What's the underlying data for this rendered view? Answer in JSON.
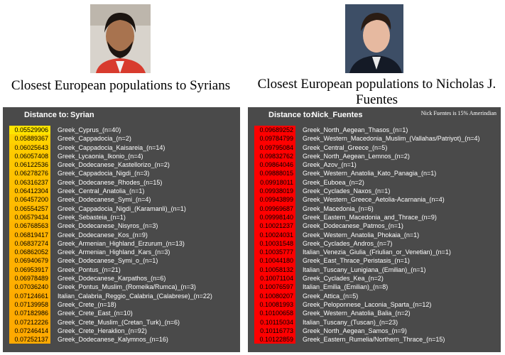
{
  "left": {
    "caption": "Closest European populations to Syrians",
    "header": {
      "label": "Distance to:",
      "population": "Syrian"
    },
    "rows": [
      {
        "value": "0.05529906",
        "name": "Greek_Cyprus_(n=40)",
        "color": "#ffe400"
      },
      {
        "value": "0.05889367",
        "name": "Greek_Cappadocia_(n=2)",
        "color": "#ffd200"
      },
      {
        "value": "0.06025643",
        "name": "Greek_Cappadocia_Kaisareia_(n=14)",
        "color": "#ffcc00"
      },
      {
        "value": "0.06057408",
        "name": "Greek_Lycaonia_Ikonio_(n=4)",
        "color": "#ffca00"
      },
      {
        "value": "0.06122536",
        "name": "Greek_Dodecanese_Kastellorizo_(n=2)",
        "color": "#ffc700"
      },
      {
        "value": "0.06278276",
        "name": "Greek_Cappadocia_Nigdi_(n=3)",
        "color": "#ffc200"
      },
      {
        "value": "0.06316237",
        "name": "Greek_Dodecanese_Rhodes_(n=15)",
        "color": "#ffc000"
      },
      {
        "value": "0.06412304",
        "name": "Greek_Central_Anatolia_(n=1)",
        "color": "#ffbe00"
      },
      {
        "value": "0.06457200",
        "name": "Greek_Dodecanese_Symi_(n=4)",
        "color": "#ffbc00"
      },
      {
        "value": "0.06554257",
        "name": "Greek_Cappadocia_Nigdi_(Karamanli)_(n=1)",
        "color": "#ffba00"
      },
      {
        "value": "0.06579434",
        "name": "Greek_Sebasteia_(n=1)",
        "color": "#ffb900"
      },
      {
        "value": "0.06768563",
        "name": "Greek_Dodecanese_Nisyros_(n=3)",
        "color": "#ffb500"
      },
      {
        "value": "0.06819417",
        "name": "Greek_Dodecanese_Kos_(n=9)",
        "color": "#ffb300"
      },
      {
        "value": "0.06837274",
        "name": "Greek_Armenian_Highland_Erzurum_(n=13)",
        "color": "#ffb300"
      },
      {
        "value": "0.06862052",
        "name": "Greek_Armenian_Highland_Kars_(n=3)",
        "color": "#ffb200"
      },
      {
        "value": "0.06940679",
        "name": "Greek_Dodecanese_Symi_o_(n=1)",
        "color": "#ffb000"
      },
      {
        "value": "0.06953917",
        "name": "Greek_Pontus_(n=21)",
        "color": "#ffb000"
      },
      {
        "value": "0.06978489",
        "name": "Greek_Dodecanese_Karpathos_(n=6)",
        "color": "#ffaf00"
      },
      {
        "value": "0.07036240",
        "name": "Greek_Pontus_Muslim_(Romeika/Rumca)_(n=3)",
        "color": "#ffae00"
      },
      {
        "value": "0.07124661",
        "name": "Italian_Calabria_Reggio_Calabria_(Calabrese)_(n=22)",
        "color": "#ffac00"
      },
      {
        "value": "0.07139958",
        "name": "Greek_Crete_(n=18)",
        "color": "#ffab00"
      },
      {
        "value": "0.07182986",
        "name": "Greek_Crete_East_(n=10)",
        "color": "#ffaa00"
      },
      {
        "value": "0.07212226",
        "name": "Greek_Crete_Muslim_(Cretan_Turk)_(n=6)",
        "color": "#ffaa00"
      },
      {
        "value": "0.07246414",
        "name": "Greek_Crete_Heraklion_(n=92)",
        "color": "#ffa900"
      },
      {
        "value": "0.07252137",
        "name": "Greek_Dodecanese_Kalymnos_(n=16)",
        "color": "#ffa900"
      }
    ]
  },
  "right": {
    "caption": "Closest European populations to Nicholas J. Fuentes",
    "header": {
      "label": "Distance to:",
      "population": "Nick_Fuentes"
    },
    "note": "Nick Fuentes is 15% Amerindian",
    "rows": [
      {
        "value": "0.09689252",
        "name": "Greek_North_Aegean_Thasos_(n=1)",
        "color": "#ff0000"
      },
      {
        "value": "0.09784799",
        "name": "Greek_Western_Macedonia_Muslim_(Vallahas/Patriyot)_(n=4)",
        "color": "#ff0000"
      },
      {
        "value": "0.09795084",
        "name": "Greek_Central_Greece_(n=5)",
        "color": "#ff0000"
      },
      {
        "value": "0.09832762",
        "name": "Greek_North_Aegean_Lemnos_(n=2)",
        "color": "#ff0000"
      },
      {
        "value": "0.09864046",
        "name": "Greek_Azov_(n=1)",
        "color": "#ff0000"
      },
      {
        "value": "0.09888015",
        "name": "Greek_Western_Anatolia_Kato_Panagia_(n=1)",
        "color": "#ff0000"
      },
      {
        "value": "0.09918011",
        "name": "Greek_Euboea_(n=2)",
        "color": "#ff0000"
      },
      {
        "value": "0.09938019",
        "name": "Greek_Cyclades_Naxos_(n=1)",
        "color": "#ff0000"
      },
      {
        "value": "0.09943899",
        "name": "Greek_Western_Greece_Aetolia-Acarnania_(n=4)",
        "color": "#ff0000"
      },
      {
        "value": "0.09969687",
        "name": "Greek_Macedonia_(n=6)",
        "color": "#ff0000"
      },
      {
        "value": "0.09998140",
        "name": "Greek_Eastern_Macedonia_and_Thrace_(n=9)",
        "color": "#ff0000"
      },
      {
        "value": "0.10021237",
        "name": "Greek_Dodecanese_Patmos_(n=1)",
        "color": "#ff0000"
      },
      {
        "value": "0.10024031",
        "name": "Greek_Western_Anatolia_Phokaia_(n=1)",
        "color": "#ff0000"
      },
      {
        "value": "0.10031548",
        "name": "Greek_Cyclades_Andros_(n=7)",
        "color": "#ff0000"
      },
      {
        "value": "0.10035777",
        "name": "Italian_Venezia_Giulia_(Friulian_or_Venetian)_(n=1)",
        "color": "#ff0000"
      },
      {
        "value": "0.10044180",
        "name": "Greek_East_Thrace_Peristasis_(n=1)",
        "color": "#ff0000"
      },
      {
        "value": "0.10058132",
        "name": "Italian_Tuscany_Lunigiana_(Emilian)_(n=1)",
        "color": "#ff0000"
      },
      {
        "value": "0.10071104",
        "name": "Greek_Cyclades_Kea_(n=2)",
        "color": "#ff0000"
      },
      {
        "value": "0.10076597",
        "name": "Italian_Emilia_(Emilian)_(n=8)",
        "color": "#ff0000"
      },
      {
        "value": "0.10080207",
        "name": "Greek_Attica_(n=5)",
        "color": "#ff0000"
      },
      {
        "value": "0.10081993",
        "name": "Greek_Peloponnese_Laconia_Sparta_(n=12)",
        "color": "#ff0000"
      },
      {
        "value": "0.10100658",
        "name": "Greek_Western_Anatolia_Balia_(n=2)",
        "color": "#ff0000"
      },
      {
        "value": "0.10115034",
        "name": "Italian_Tuscany_(Tuscan)_(n=23)",
        "color": "#ff0000"
      },
      {
        "value": "0.10116773",
        "name": "Greek_North_Aegean_Samos_(n=9)",
        "color": "#ff0000"
      },
      {
        "value": "0.10122859",
        "name": "Greek_Eastern_Rumelia/Northern_Thrace_(n=15)",
        "color": "#ff0000"
      }
    ]
  }
}
